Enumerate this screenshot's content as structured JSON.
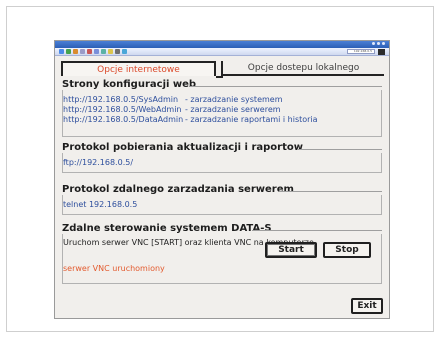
{
  "window": {
    "tray_label": "192.168.0.5"
  },
  "tabs": [
    {
      "label": "Opcje internetowe"
    },
    {
      "label": "Opcje dostepu lokalnego"
    }
  ],
  "sections": {
    "web_config": {
      "title": "Strony konfiguracji web",
      "rows": [
        {
          "url": "http://192.168.0.5/SysAdmin",
          "desc": "- zarzadzanie systemem"
        },
        {
          "url": "http://192.168.0.5/WebAdmin",
          "desc": "- zarzadzanie serwerem"
        },
        {
          "url": "http://192.168.0.5/DataAdmin",
          "desc": "- zarzadzanie raportami i historia"
        }
      ]
    },
    "download_protocol": {
      "title": "Protokol pobierania aktualizacji i raportow",
      "value": "ftp://192.168.0.5/"
    },
    "remote_management": {
      "title": "Protokol zdalnego zarzadzania serwerem",
      "value": "telnet 192.168.0.5"
    },
    "remote_control": {
      "title": "Zdalne sterowanie systemem DATA-S",
      "instruction": "Uruchom serwer VNC [START] oraz klienta VNC na komputerze",
      "status": "serwer VNC uruchomiony"
    }
  },
  "buttons": {
    "start": "Start",
    "stop": "Stop",
    "exit": "Exit"
  },
  "colors": {
    "active_tab": "#db4a2c",
    "link": "#2e4f9d",
    "status": "#e35b2f"
  }
}
